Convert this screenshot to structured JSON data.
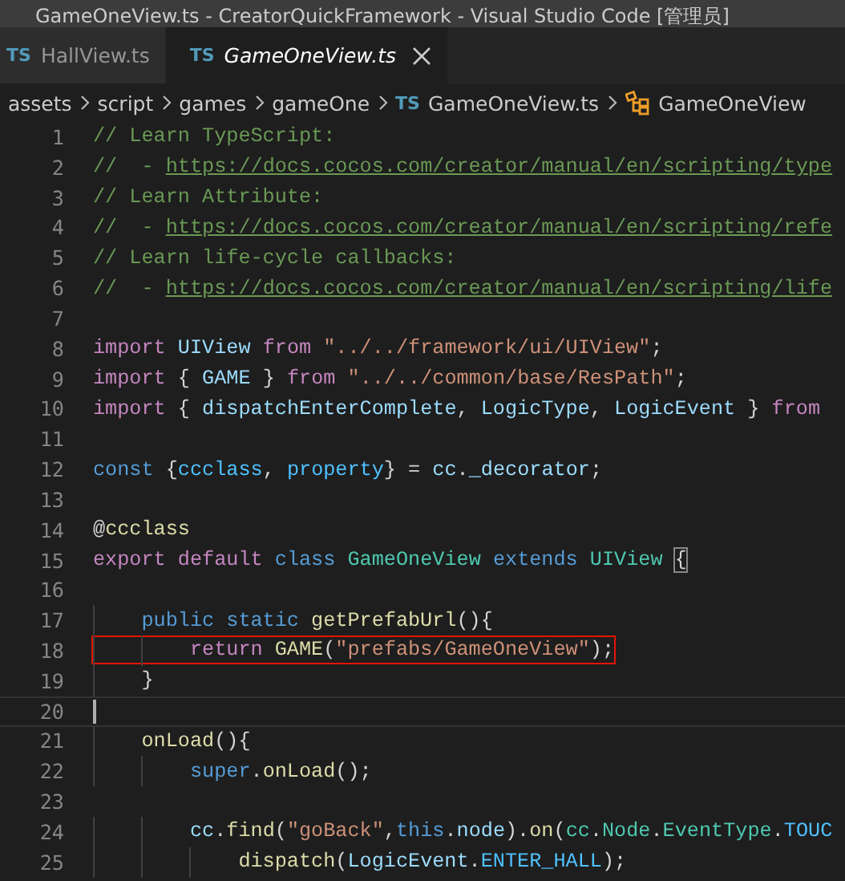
{
  "window": {
    "title": "GameOneView.ts - CreatorQuickFramework - Visual Studio Code [管理员]"
  },
  "tabs": [
    {
      "label": "HallView.ts",
      "icon": "TS",
      "selected": false,
      "preview": false,
      "closable": false
    },
    {
      "label": "GameOneView.ts",
      "icon": "TS",
      "selected": true,
      "preview": true,
      "closable": true
    }
  ],
  "breadcrumb": [
    {
      "kind": "folder",
      "label": "assets"
    },
    {
      "kind": "folder",
      "label": "script"
    },
    {
      "kind": "folder",
      "label": "games"
    },
    {
      "kind": "folder",
      "label": "gameOne"
    },
    {
      "kind": "file",
      "label": "GameOneView.ts",
      "icon": "TS"
    },
    {
      "kind": "symbol",
      "label": "GameOneView"
    }
  ],
  "editor": {
    "lines": [
      {
        "number": "1",
        "tokens": [
          {
            "kind": "comment",
            "text": "// Learn TypeScript:"
          }
        ]
      },
      {
        "number": "2",
        "tokens": [
          {
            "kind": "comment",
            "text": "//  - "
          },
          {
            "kind": "link",
            "text": "https://docs.cocos.com/creator/manual/en/scripting/type"
          }
        ]
      },
      {
        "number": "3",
        "tokens": [
          {
            "kind": "comment",
            "text": "// Learn Attribute:"
          }
        ]
      },
      {
        "number": "4",
        "tokens": [
          {
            "kind": "comment",
            "text": "//  - "
          },
          {
            "kind": "link",
            "text": "https://docs.cocos.com/creator/manual/en/scripting/refe"
          }
        ]
      },
      {
        "number": "5",
        "tokens": [
          {
            "kind": "comment",
            "text": "// Learn life-cycle callbacks:"
          }
        ]
      },
      {
        "number": "6",
        "tokens": [
          {
            "kind": "comment",
            "text": "//  - "
          },
          {
            "kind": "link",
            "text": "https://docs.cocos.com/creator/manual/en/scripting/life"
          }
        ]
      },
      {
        "number": "7"
      },
      {
        "number": "8",
        "tokens": [
          {
            "kind": "control",
            "text": "import"
          },
          {
            "kind": "variable",
            "text": " UIView"
          },
          {
            "kind": "control",
            "text": " from"
          },
          {
            "kind": "string",
            "text": " \"../../framework/ui/UIView\""
          },
          {
            "kind": "plain",
            "text": ";"
          }
        ]
      },
      {
        "number": "9",
        "tokens": [
          {
            "kind": "control",
            "text": "import"
          },
          {
            "kind": "plain",
            "text": " {"
          },
          {
            "kind": "variable",
            "text": " GAME"
          },
          {
            "kind": "plain",
            "text": " }"
          },
          {
            "kind": "control",
            "text": " from"
          },
          {
            "kind": "string",
            "text": " \"../../common/base/ResPath\""
          },
          {
            "kind": "plain",
            "text": ";"
          }
        ]
      },
      {
        "number": "10",
        "tokens": [
          {
            "kind": "control",
            "text": "import"
          },
          {
            "kind": "plain",
            "text": " {"
          },
          {
            "kind": "variable",
            "text": " dispatchEnterComplete"
          },
          {
            "kind": "plain",
            "text": ","
          },
          {
            "kind": "variable",
            "text": " LogicType"
          },
          {
            "kind": "plain",
            "text": ","
          },
          {
            "kind": "variable",
            "text": " LogicEvent"
          },
          {
            "kind": "plain",
            "text": " }"
          },
          {
            "kind": "control",
            "text": " from"
          }
        ]
      },
      {
        "number": "11"
      },
      {
        "number": "12",
        "tokens": [
          {
            "kind": "keyword",
            "text": "const"
          },
          {
            "kind": "plain",
            "text": " {"
          },
          {
            "kind": "constant",
            "text": "ccclass"
          },
          {
            "kind": "plain",
            "text": ","
          },
          {
            "kind": "constant",
            "text": " property"
          },
          {
            "kind": "plain",
            "text": "} ="
          },
          {
            "kind": "variable",
            "text": " cc"
          },
          {
            "kind": "plain",
            "text": "."
          },
          {
            "kind": "variable",
            "text": "_decorator"
          },
          {
            "kind": "plain",
            "text": ";"
          }
        ]
      },
      {
        "number": "13"
      },
      {
        "number": "14",
        "tokens": [
          {
            "kind": "plain",
            "text": "@"
          },
          {
            "kind": "function",
            "text": "ccclass"
          }
        ]
      },
      {
        "number": "15",
        "tokens": [
          {
            "kind": "control",
            "text": "export"
          },
          {
            "kind": "control",
            "text": " default"
          },
          {
            "kind": "keyword",
            "text": " class"
          },
          {
            "kind": "type",
            "text": " GameOneView"
          },
          {
            "kind": "keyword",
            "text": " extends"
          },
          {
            "kind": "type",
            "text": " UIView "
          },
          {
            "kind": "bracket",
            "text": "{"
          }
        ]
      },
      {
        "number": "16"
      },
      {
        "number": "17",
        "tokens": [
          {
            "kind": "keyword",
            "text": "    public"
          },
          {
            "kind": "keyword",
            "text": " static"
          },
          {
            "kind": "function",
            "text": " getPrefabUrl"
          },
          {
            "kind": "plain",
            "text": "(){"
          }
        ]
      },
      {
        "number": "18",
        "highlighted": true,
        "tokens": [
          {
            "kind": "control",
            "text": "        return"
          },
          {
            "kind": "function",
            "text": " GAME"
          },
          {
            "kind": "plain",
            "text": "("
          },
          {
            "kind": "string",
            "text": "\"prefabs/GameOneView\""
          },
          {
            "kind": "plain",
            "text": ");"
          }
        ]
      },
      {
        "number": "19",
        "tokens": [
          {
            "kind": "plain",
            "text": "    }"
          }
        ]
      },
      {
        "number": "20",
        "current": true
      },
      {
        "number": "21",
        "tokens": [
          {
            "kind": "function",
            "text": "    onLoad"
          },
          {
            "kind": "plain",
            "text": "(){"
          }
        ]
      },
      {
        "number": "22",
        "tokens": [
          {
            "kind": "keyword",
            "text": "        super"
          },
          {
            "kind": "plain",
            "text": "."
          },
          {
            "kind": "function",
            "text": "onLoad"
          },
          {
            "kind": "plain",
            "text": "();"
          }
        ]
      },
      {
        "number": "23"
      },
      {
        "number": "24",
        "tokens": [
          {
            "kind": "variable",
            "text": "        cc"
          },
          {
            "kind": "plain",
            "text": "."
          },
          {
            "kind": "function",
            "text": "find"
          },
          {
            "kind": "plain",
            "text": "("
          },
          {
            "kind": "string",
            "text": "\"goBack\""
          },
          {
            "kind": "plain",
            "text": ","
          },
          {
            "kind": "keyword",
            "text": "this"
          },
          {
            "kind": "plain",
            "text": "."
          },
          {
            "kind": "variable",
            "text": "node"
          },
          {
            "kind": "plain",
            "text": ")."
          },
          {
            "kind": "function",
            "text": "on"
          },
          {
            "kind": "plain",
            "text": "("
          },
          {
            "kind": "type",
            "text": "cc"
          },
          {
            "kind": "plain",
            "text": "."
          },
          {
            "kind": "type",
            "text": "Node"
          },
          {
            "kind": "plain",
            "text": "."
          },
          {
            "kind": "type",
            "text": "EventType"
          },
          {
            "kind": "plain",
            "text": "."
          },
          {
            "kind": "constant",
            "text": "TOUC"
          }
        ]
      },
      {
        "number": "25",
        "tokens": [
          {
            "kind": "function",
            "text": "            dispatch"
          },
          {
            "kind": "plain",
            "text": "("
          },
          {
            "kind": "variable",
            "text": "LogicEvent"
          },
          {
            "kind": "plain",
            "text": "."
          },
          {
            "kind": "constant",
            "text": "ENTER_HALL"
          },
          {
            "kind": "plain",
            "text": ");"
          }
        ]
      }
    ]
  }
}
